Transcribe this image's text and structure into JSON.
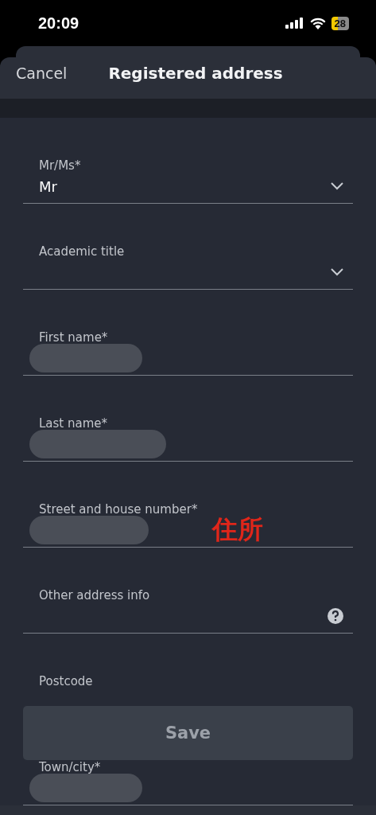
{
  "status_bar": {
    "time": "20:09",
    "battery": "28"
  },
  "header": {
    "cancel": "Cancel",
    "title": "Registered address"
  },
  "fields": [
    {
      "kind": "select",
      "label": "Mr/Ms*",
      "value": "Mr",
      "redacted": false
    },
    {
      "kind": "select",
      "label": "Academic title",
      "redacted": false
    },
    {
      "kind": "text",
      "label": "First name*",
      "redacted": true
    },
    {
      "kind": "text",
      "label": "Last name*",
      "redacted": true
    },
    {
      "kind": "text",
      "label": "Street and house number*",
      "redacted": true,
      "annotation": "住所"
    },
    {
      "kind": "help",
      "label": "Other address info",
      "redacted": false
    },
    {
      "kind": "text",
      "label": "Postcode",
      "redacted": false
    },
    {
      "kind": "text",
      "label": "Town/city*",
      "redacted": true
    }
  ],
  "save_button": "Save"
}
